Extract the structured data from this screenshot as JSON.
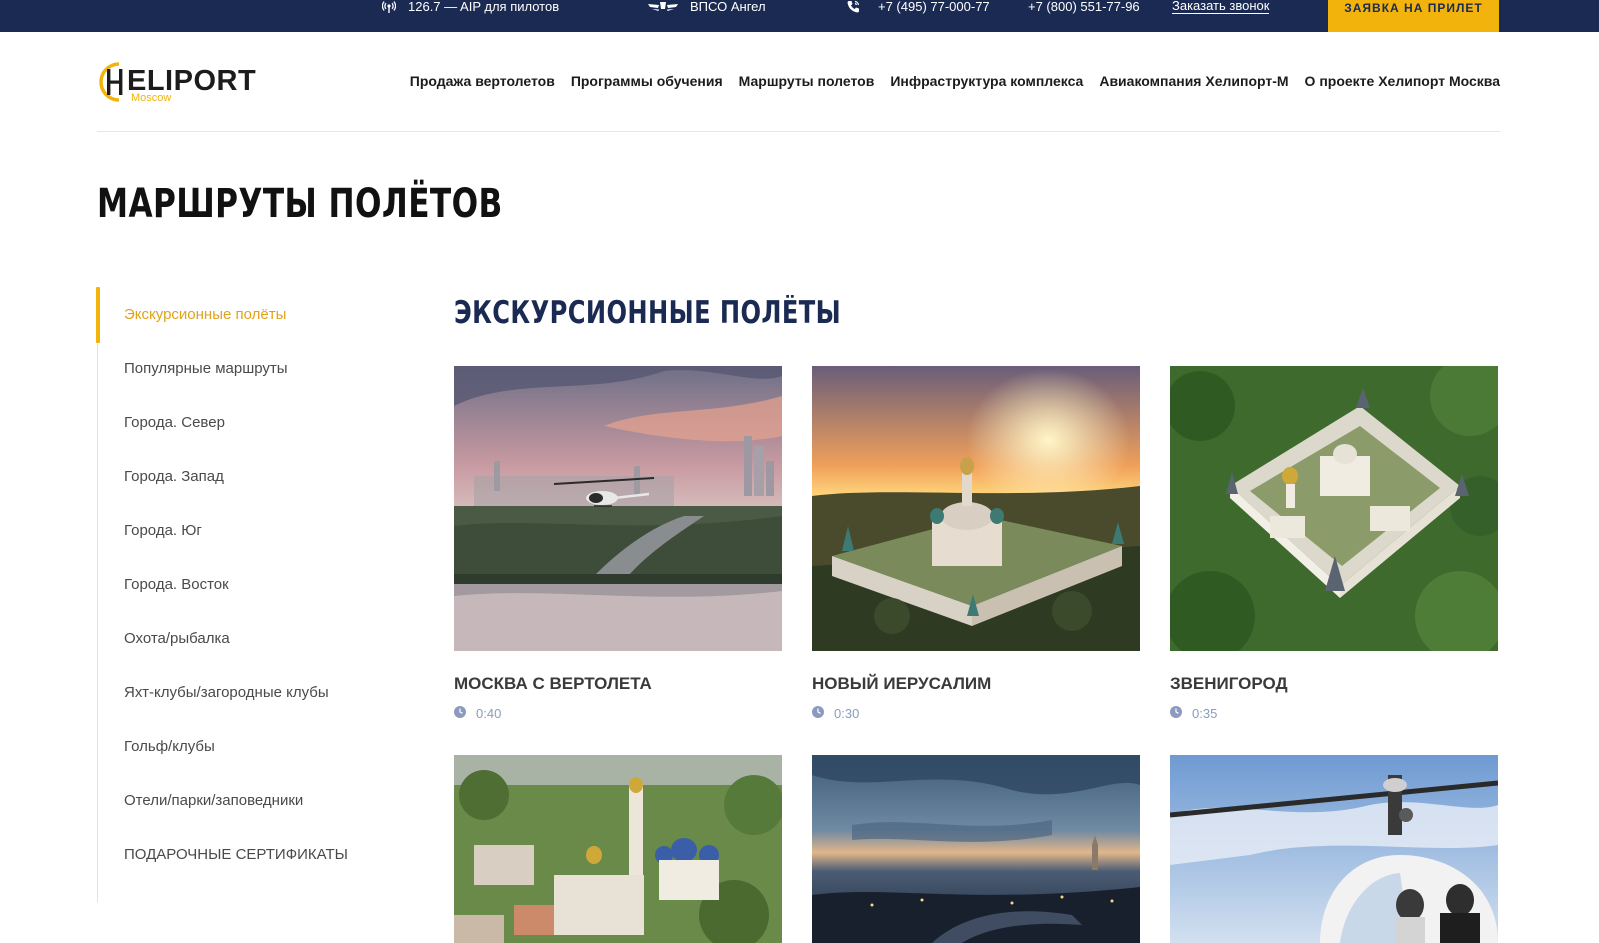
{
  "topbar": {
    "aip_text": "126.7 — AIP для пилотов",
    "vpso_text": "ВПСО Ангел",
    "phone1": "+7 (495) 77-000-77",
    "phone2": "+7 (800) 551-77-96",
    "callback_label": "Заказать звонок",
    "cta_label": "ЗАЯВКА НА ПРИЛЕТ",
    "cta_color": "#f2b40c",
    "bg_color": "#1a2a52"
  },
  "logo": {
    "text": "ELIPORT",
    "sub": "Moscow"
  },
  "nav": [
    "Продажа вертолетов",
    "Программы обучения",
    "Маршруты полетов",
    "Инфраструктура комплекса",
    "Авиакомпания Хелипорт-М",
    "О проекте Хелипорт Москва"
  ],
  "page_title": "МАРШРУТЫ ПОЛЁТОВ",
  "sidebar": {
    "items": [
      {
        "label": "Экскурсионные полёты",
        "active": true
      },
      {
        "label": "Популярные маршруты",
        "active": false
      },
      {
        "label": "Города. Север",
        "active": false
      },
      {
        "label": "Города. Запад",
        "active": false
      },
      {
        "label": "Города. Юг",
        "active": false
      },
      {
        "label": "Города. Восток",
        "active": false
      },
      {
        "label": "Охота/рыбалка",
        "active": false
      },
      {
        "label": "Яхт-клубы/загородные клубы",
        "active": false
      },
      {
        "label": "Гольф/клубы",
        "active": false
      },
      {
        "label": "Отели/парки/заповедники",
        "active": false
      },
      {
        "label": "ПОДАРОЧНЫЕ СЕРТИФИКАТЫ",
        "active": false
      }
    ]
  },
  "section_title": "ЭКСКУРСИОННЫЕ ПОЛЁТЫ",
  "cards": [
    {
      "title": "МОСКВА С ВЕРТОЛЕТА",
      "time": "0:40"
    },
    {
      "title": "НОВЫЙ ИЕРУСАЛИМ",
      "time": "0:30"
    },
    {
      "title": "ЗВЕНИГОРОД",
      "time": "0:35"
    },
    {
      "title": "",
      "time": ""
    },
    {
      "title": "",
      "time": ""
    },
    {
      "title": "",
      "time": ""
    }
  ],
  "accent_color": "#f2b40c",
  "icons": [
    "antenna-icon",
    "wings-icon",
    "phone-icon",
    "clock-icon"
  ]
}
